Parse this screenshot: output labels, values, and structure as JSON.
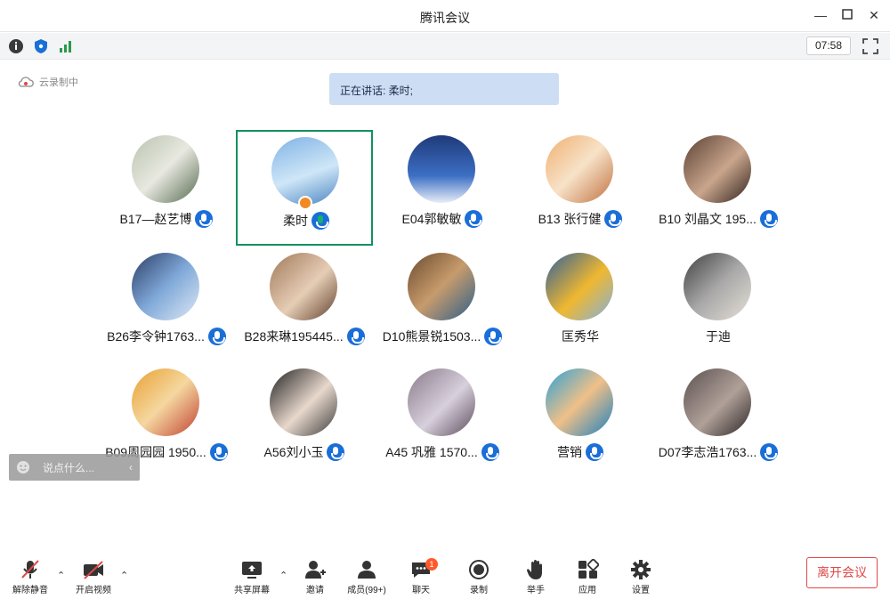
{
  "window": {
    "title": "腾讯会议"
  },
  "top_toolbar": {
    "timer": "07:58"
  },
  "status": {
    "recording_label": "云录制中",
    "speaking_label": "正在讲话: 柔时;"
  },
  "participants": [
    {
      "name": "B17—赵艺博",
      "mic": "blue"
    },
    {
      "name": "柔时",
      "mic": "green",
      "active": true
    },
    {
      "name": "E04郭敏敏",
      "mic": "blue"
    },
    {
      "name": "B13 张行健",
      "mic": "blue"
    },
    {
      "name": "B10  刘晶文 195...",
      "mic": "blue"
    },
    {
      "name": "B26李令钟1763...",
      "mic": "blue"
    },
    {
      "name": "B28来琳195445...",
      "mic": "blue"
    },
    {
      "name": "D10熊景锐1503...",
      "mic": "blue"
    },
    {
      "name": "匡秀华",
      "mic": "none"
    },
    {
      "name": "于迪",
      "mic": "none"
    },
    {
      "name": "B09周园园 1950...",
      "mic": "blue"
    },
    {
      "name": "A56刘小玉",
      "mic": "blue"
    },
    {
      "name": "A45 巩雅  1570...",
      "mic": "blue"
    },
    {
      "name": "营销",
      "mic": "blue"
    },
    {
      "name": "D07李志浩1763...",
      "mic": "blue"
    }
  ],
  "chat_input": {
    "placeholder": "说点什么..."
  },
  "bottom_bar": {
    "unmute": "解除静音",
    "video": "开启视频",
    "share": "共享屏幕",
    "invite": "邀请",
    "members": "成员(99+)",
    "chat": "聊天",
    "chat_badge": "1",
    "record": "录制",
    "raise_hand": "举手",
    "apps": "应用",
    "settings": "设置",
    "leave": "离开会议"
  },
  "colors": {
    "accent": "#1a6ed8",
    "active_border": "#13915f",
    "leave": "#e04848",
    "speaking_bg": "#cdddf4"
  }
}
